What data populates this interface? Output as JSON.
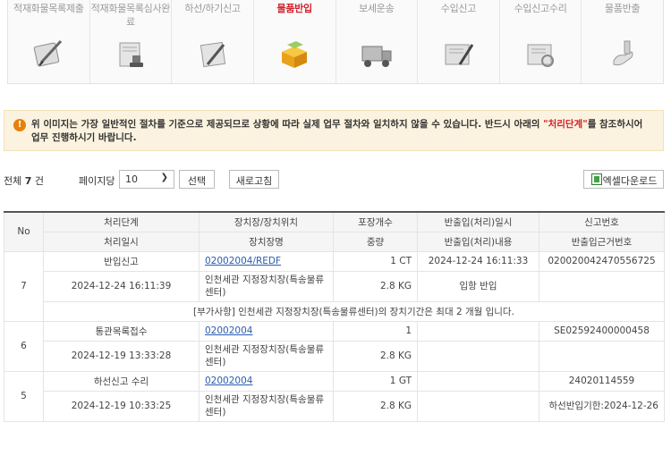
{
  "steps": [
    {
      "label": "적재화물목록제출",
      "icon": "manifest-pen-icon",
      "active": false
    },
    {
      "label": "적재화물목록심사완료",
      "icon": "stamp-document-icon",
      "active": false
    },
    {
      "label": "하선/하기신고",
      "icon": "pen-document-icon",
      "active": false
    },
    {
      "label": "물품반입",
      "icon": "boxes-icon",
      "active": true
    },
    {
      "label": "보세운송",
      "icon": "truck-icon",
      "active": false
    },
    {
      "label": "수입신고",
      "icon": "declaration-pen-icon",
      "active": false
    },
    {
      "label": "수입신고수리",
      "icon": "approval-document-icon",
      "active": false
    },
    {
      "label": "물품반출",
      "icon": "release-hand-icon",
      "active": false
    }
  ],
  "notice": {
    "text_before": "위 이미지는 가장 일반적인 절차를 기준으로 제공되므로 상황에 따라 실제 업무 절차와 일치하지 않을 수 있습니다. 반드시 아래의 ",
    "highlight": "\"처리단계\"",
    "text_after": "를 참조하시어 업무 진행하시기 바랍니다."
  },
  "toolbar": {
    "total_prefix": "전체",
    "total_count": "7",
    "total_suffix": "건",
    "perpage_label": "페이지당",
    "perpage_value": "10",
    "select_label": "선택",
    "refresh_label": "새로고침",
    "excel_label": "엑셀다운로드"
  },
  "table": {
    "headers": {
      "no": "No",
      "row1": [
        "처리단계",
        "장치장/장치위치",
        "포장개수",
        "반출입(처리)일시",
        "신고번호"
      ],
      "row2": [
        "처리일시",
        "장치장명",
        "중량",
        "반출입(처리)내용",
        "반출입근거번호"
      ]
    },
    "records": [
      {
        "no": "7",
        "stage": "반입신고",
        "location": "02002004/REDF",
        "packages": "1 CT",
        "inout_datetime": "2024-12-24 16:11:33",
        "declaration_no": "020020042470556725",
        "processed_at": "2024-12-24 16:11:39",
        "warehouse_name": "인천세관 지정장치장(특송물류센터)",
        "weight": "2.8 KG",
        "inout_content": "입항 반입",
        "basis_no": "",
        "note": "[부가사항] 인천세관 지정장치장(특송물류센터)의 장치기간은 최대 2 개월 입니다."
      },
      {
        "no": "6",
        "stage": "통관목록접수",
        "location": "02002004",
        "packages": "1",
        "inout_datetime": "",
        "declaration_no": "SE02592400000458",
        "processed_at": "2024-12-19 13:33:28",
        "warehouse_name": "인천세관 지정장치장(특송물류센터)",
        "weight": "2.8 KG",
        "inout_content": "",
        "basis_no": ""
      },
      {
        "no": "5",
        "stage": "하선신고 수리",
        "location": "02002004",
        "packages": "1 GT",
        "inout_datetime": "",
        "declaration_no": "24020114559",
        "processed_at": "2024-12-19 10:33:25",
        "warehouse_name": "인천세관 지정장치장(특송물류센터)",
        "weight": "2.8 KG",
        "inout_content": "",
        "basis_no": "하선반입기한:2024-12-26"
      }
    ]
  },
  "colors": {
    "accent": "#d4212d",
    "notice_bg": "#fbf3df",
    "notice_icon": "#e8800c",
    "link": "#2a5db0"
  }
}
